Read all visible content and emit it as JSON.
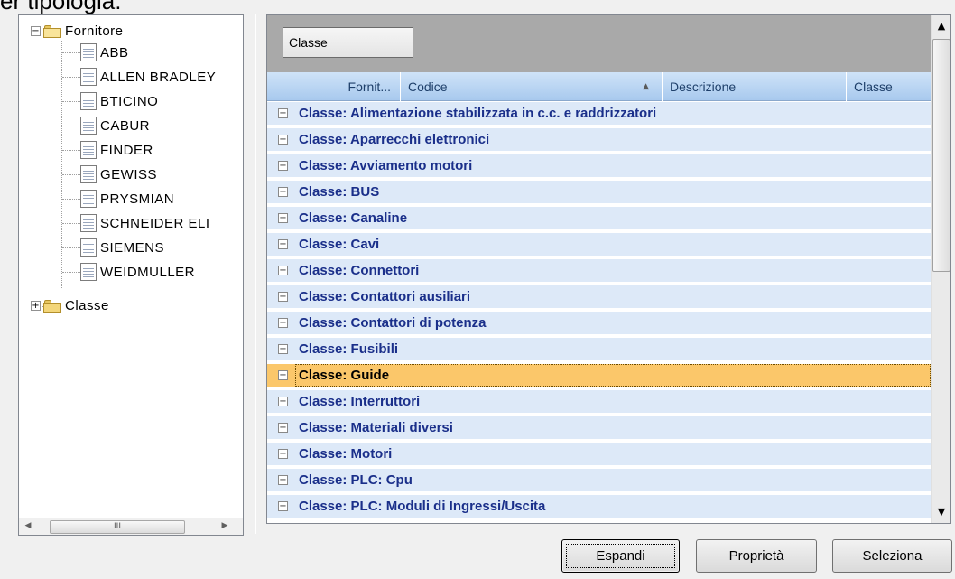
{
  "top_text": "er tipologia:",
  "tree": {
    "root_label": "Fornitore",
    "suppliers": [
      "ABB",
      "ALLEN BRADLEY",
      "BTICINO",
      "CABUR",
      "FINDER",
      "GEWISS",
      "PRYSMIAN",
      "SCHNEIDER ELI",
      "SIEMENS",
      "WEIDMULLER"
    ],
    "second_root_label": "Classe",
    "expander_open": "−",
    "expander_closed": "+",
    "scroll_thumb_grip": "III",
    "scroll_left": "◀",
    "scroll_right": "▶"
  },
  "grid": {
    "group_by": "Classe",
    "columns": [
      "Fornit...",
      "Codice",
      "Descrizione",
      "Classe"
    ],
    "sort_indicator": "▲",
    "rows": [
      "Classe: Alimentazione stabilizzata in c.c. e raddrizzatori",
      "Classe: Aparrecchi elettronici",
      "Classe: Avviamento motori",
      "Classe: BUS",
      "Classe: Canaline",
      "Classe: Cavi",
      "Classe: Connettori",
      "Classe: Contattori ausiliari",
      "Classe: Contattori di potenza",
      "Classe: Fusibili",
      "Classe: Guide",
      "Classe: Interruttori",
      "Classe: Materiali diversi",
      "Classe: Motori",
      "Classe: PLC: Cpu",
      "Classe: PLC: Moduli di Ingressi/Uscita"
    ],
    "selected_row": "Classe: Guide",
    "row_expander": "+",
    "scroll_up": "▲",
    "scroll_down": "▼"
  },
  "buttons": {
    "expand": "Espandi",
    "properties": "Proprietà",
    "select": "Seleziona"
  },
  "colors": {
    "row_background": "#dde9f8",
    "selected_row": "#fbc76a",
    "row_text": "#1a2f8a",
    "group_area": "#a9a9a9"
  }
}
